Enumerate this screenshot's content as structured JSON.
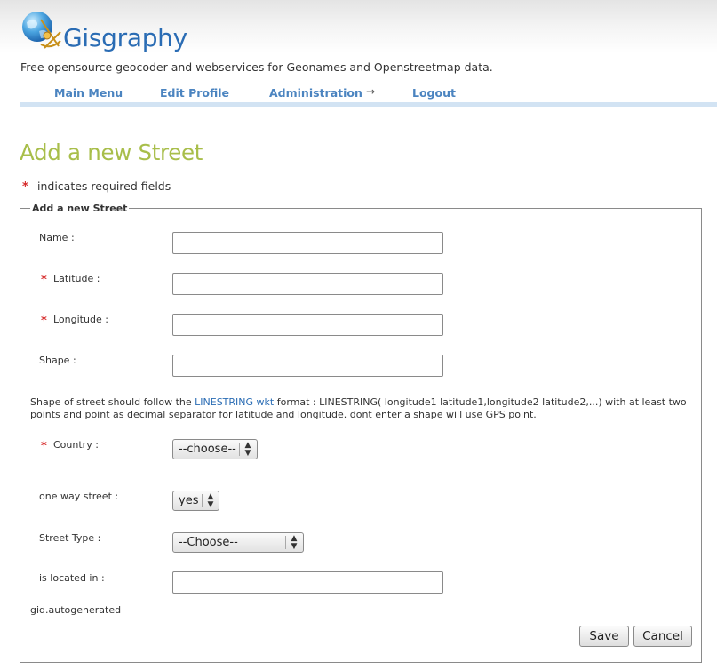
{
  "site": {
    "title": "Gisgraphy",
    "tagline": "Free opensource geocoder and webservices for Geonames and Openstreetmap data."
  },
  "nav": {
    "main_menu": "Main Menu",
    "edit_profile": "Edit Profile",
    "administration": "Administration",
    "administration_arrow": "→",
    "logout": "Logout"
  },
  "page": {
    "title": "Add a new Street",
    "required_star": "*",
    "required_note": "indicates required fields"
  },
  "form": {
    "legend": "Add a new Street",
    "name_label": "Name :",
    "latitude_label": "Latitude :",
    "longitude_label": "Longitude :",
    "shape_label": "Shape :",
    "help_before": "Shape of street should follow the ",
    "help_link": "LINESTRING wkt",
    "help_after": " format : LINESTRING( longitude1 latitude1,longitude2 latitude2,...) with at least two points and point as decimal separator for latitude and longitude. dont enter a shape will use GPS point.",
    "country_label": "Country :",
    "country_value": "--choose--",
    "one_way_label": "one way street :",
    "one_way_value": "yes",
    "street_type_label": "Street Type :",
    "street_type_value": "--Choose--",
    "located_in_label": "is located in :",
    "gid_text": "gid.autogenerated",
    "save_label": "Save",
    "cancel_label": "Cancel"
  },
  "colors": {
    "title_green": "#a8be4a",
    "brand_blue": "#2a6cb4",
    "nav_blue": "#4b84c0",
    "required_red": "#d62a2a"
  }
}
